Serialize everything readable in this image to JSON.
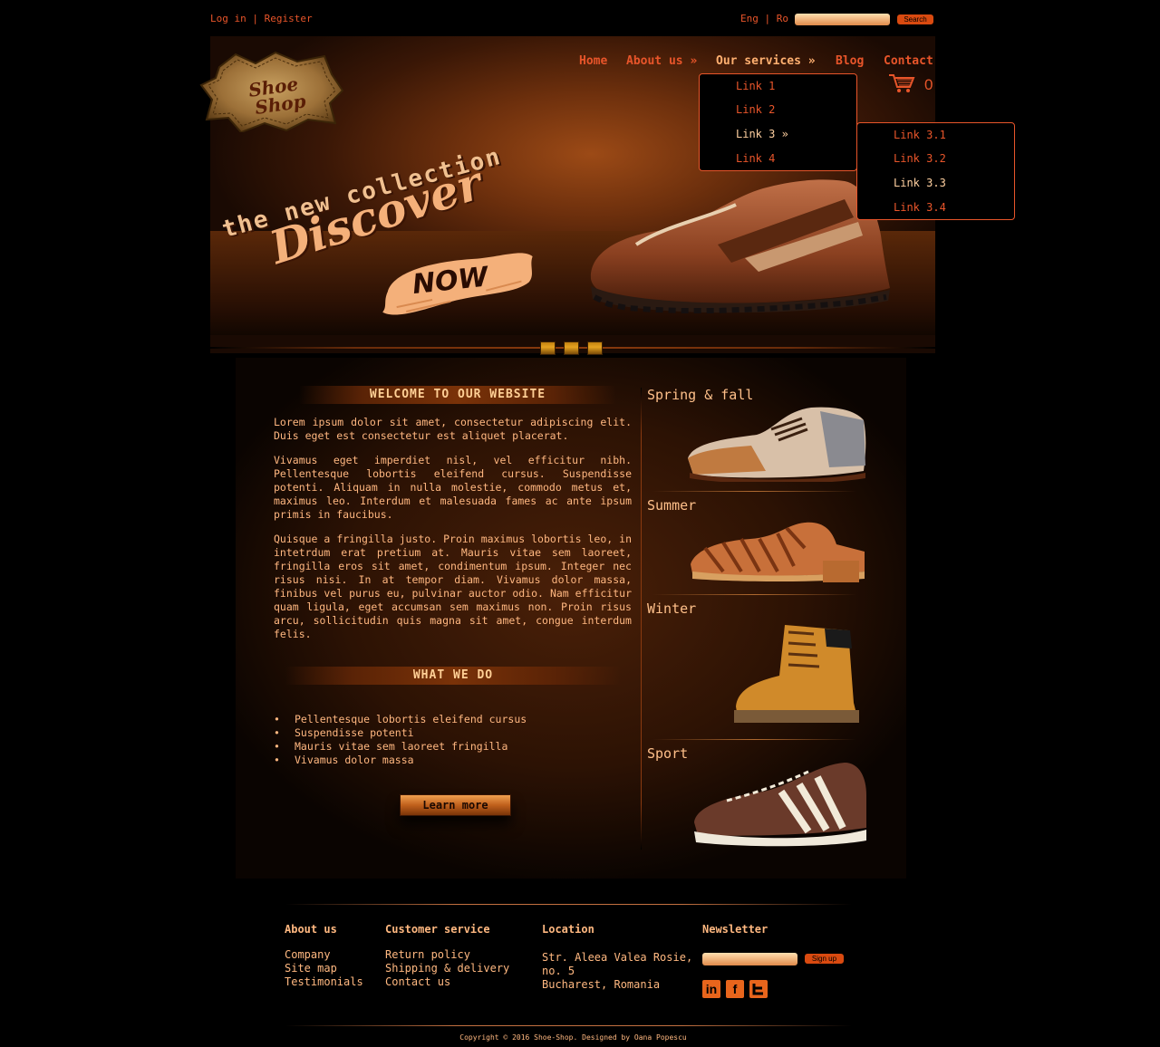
{
  "topbar": {
    "login": "Log in",
    "separator": "|",
    "register": "Register",
    "lang_en": "Eng",
    "lang_ro": "Ro",
    "search_label": "Search"
  },
  "logo": {
    "line1": "Shoe",
    "line2": "Shop"
  },
  "nav": {
    "items": [
      "Home",
      "About us »",
      "Our services »",
      "Blog",
      "Contact"
    ],
    "active": "Our services »"
  },
  "cart": {
    "count": "0",
    "icon": "cart-icon"
  },
  "dropdown_services": [
    "Link 1",
    "Link 2",
    "Link 3 »",
    "Link 4"
  ],
  "dropdown_link3": [
    "Link 3.1",
    "Link 3.2",
    "Link 3.3",
    "Link 3.4"
  ],
  "banner": {
    "line1": "Discover",
    "line2": "the new collection",
    "cta": "NOW"
  },
  "welcome": {
    "heading": "WELCOME TO OUR WEBSITE",
    "p1": "Lorem ipsum dolor sit amet, consectetur adipiscing elit. Duis eget est consectetur est aliquet placerat.",
    "p2": "Vivamus eget imperdiet nisl, vel efficitur nibh. Pellentesque lobortis eleifend cursus. Suspendisse potenti. Aliquam in nulla molestie, commodo metus et, maximus leo. Interdum et malesuada fames ac ante ipsum primis in faucibus.",
    "p3": "Quisque a fringilla justo. Proin maximus lobortis leo, in intetrdum erat pretium at. Mauris vitae sem laoreet, fringilla eros sit amet, condimentum ipsum. Integer nec risus nisi. In at tempor diam. Vivamus dolor massa, finibus vel purus eu, pulvinar auctor odio. Nam efficitur quam ligula, eget accumsan sem maximus non. Proin risus arcu, sollicitudin quis magna sit amet, congue interdum felis."
  },
  "whatwedo": {
    "heading": "WHAT WE DO",
    "items": [
      "Pellentesque lobortis eleifend cursus",
      "Suspendisse potenti",
      "Mauris vitae sem laoreet fringilla",
      "Vivamus dolor massa"
    ],
    "button": "Learn more"
  },
  "categories": [
    "Spring & fall",
    "Summer",
    "Winter",
    "Sport"
  ],
  "footer": {
    "about": {
      "title": "About us",
      "links": [
        "Company",
        "Site map",
        "Testimonials"
      ]
    },
    "customer": {
      "title": "Customer service",
      "links": [
        "Return policy",
        "Shipping & delivery",
        "Contact us"
      ]
    },
    "location": {
      "title": "Location",
      "line1": "Str. Aleea Valea Rosie,",
      "line2": "no. 5",
      "line3": "Bucharest, Romania"
    },
    "newsletter": {
      "title": "Newsletter",
      "signup": "Sign up"
    },
    "social": [
      "linkedin-icon",
      "facebook-icon",
      "twitter-icon"
    ],
    "copyright": "Copyright © 2016 Shoe-Shop. Designed by Oana Popescu"
  },
  "colors": {
    "accent": "#e8552a",
    "text": "#ffb780",
    "bg": "#000000"
  }
}
